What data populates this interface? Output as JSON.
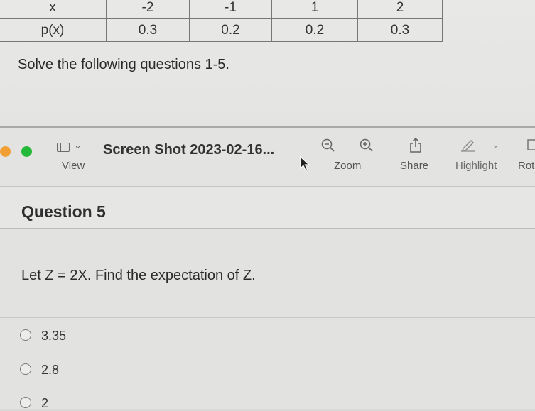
{
  "table": {
    "header_label": "x",
    "row_label": "p(x)",
    "x_values": [
      "-2",
      "-1",
      "1",
      "2"
    ],
    "p_values": [
      "0.3",
      "0.2",
      "0.2",
      "0.3"
    ]
  },
  "instructions": "Solve the following questions 1-5.",
  "toolbar": {
    "view_label": "View",
    "window_title": "Screen Shot 2023-02-16...",
    "zoom_label": "Zoom",
    "share_label": "Share",
    "highlight_label": "Highlight",
    "rotate_label": "Rot",
    "icons": [
      "sidebar-icon",
      "zoom-out-icon",
      "zoom-in-icon",
      "share-icon",
      "highlight-pen-icon",
      "rotate-icon"
    ],
    "traffic_colors": [
      "#f2a035",
      "#25b93a"
    ]
  },
  "question": {
    "title": "Question 5",
    "text": "Let Z = 2X. Find the expectation of Z.",
    "options": [
      "3.35",
      "2.8",
      "2"
    ]
  }
}
